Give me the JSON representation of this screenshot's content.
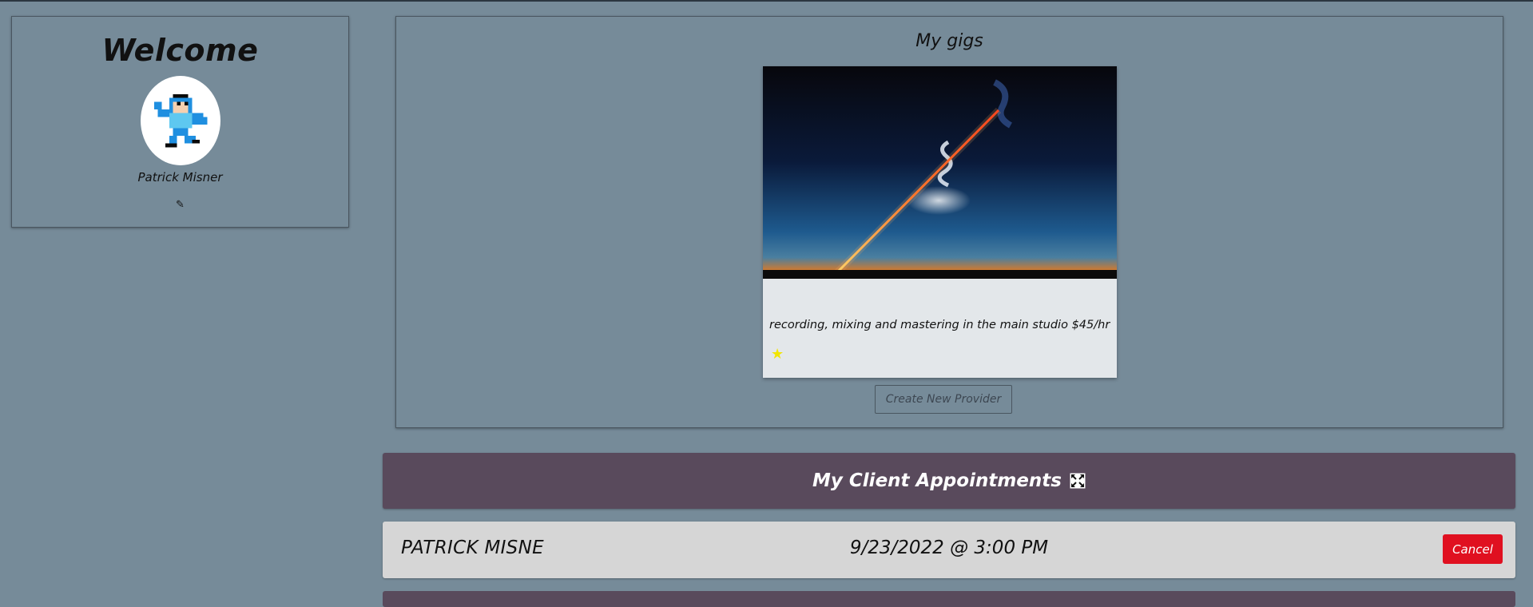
{
  "welcome": {
    "title": "Welcome",
    "user_name": "Patrick Misner",
    "edit_icon": "✎"
  },
  "gigs": {
    "title": "My gigs",
    "items": [
      {
        "description": "recording, mixing and mastering in the main studio $45/hr",
        "rating_icon": "★"
      }
    ],
    "create_button": "Create New Provider"
  },
  "appointments": {
    "title": "My Client Appointments",
    "rows": [
      {
        "client": "PATRICK MISNE",
        "datetime": "9/23/2022 @ 3:00 PM",
        "cancel_label": "Cancel"
      }
    ]
  },
  "colors": {
    "page_bg": "#768b99",
    "header_bg": "#594a5c",
    "cancel_red": "#e01020",
    "star": "#f2e600"
  }
}
